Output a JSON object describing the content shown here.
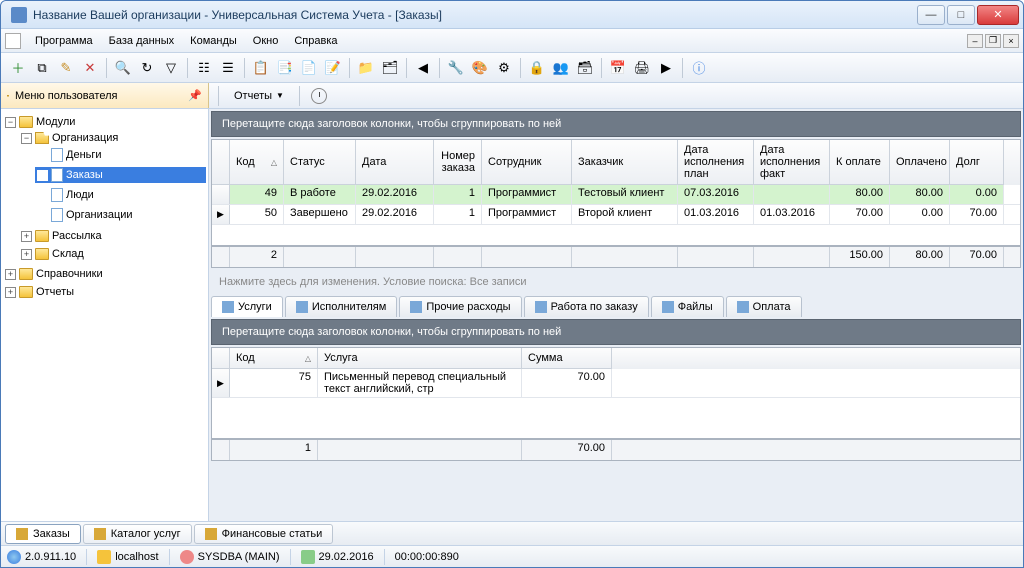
{
  "window": {
    "title": "Название Вашей организации - Универсальная Система Учета - [Заказы]"
  },
  "menu": {
    "items": [
      "Программа",
      "База данных",
      "Команды",
      "Окно",
      "Справка"
    ]
  },
  "usermenu": {
    "label": "Меню пользователя"
  },
  "reports": {
    "label": "Отчеты"
  },
  "tree": {
    "modules": "Модули",
    "org": "Организация",
    "money": "Деньги",
    "orders": "Заказы",
    "people": "Люди",
    "orgs": "Организации",
    "mail": "Рассылка",
    "warehouse": "Склад",
    "refs": "Справочники",
    "rpts": "Отчеты"
  },
  "groupbar_text": "Перетащите сюда заголовок колонки, чтобы сгруппировать по ней",
  "grid": {
    "headers": {
      "kod": "Код",
      "status": "Статус",
      "data": "Дата",
      "nomer": "Номер заказа",
      "sotr": "Сотрудник",
      "zak": "Заказчик",
      "plan": "Дата исполнения план",
      "fact": "Дата исполнения факт",
      "opl": "К оплате",
      "paid": "Оплачено",
      "dolg": "Долг"
    },
    "rows": [
      {
        "kod": "49",
        "status": "В работе",
        "data": "29.02.2016",
        "nomer": "1",
        "sotr": "Программист",
        "zak": "Тестовый клиент",
        "plan": "07.03.2016",
        "fact": "",
        "opl": "80.00",
        "paid": "80.00",
        "dolg": "0.00",
        "green": true
      },
      {
        "kod": "50",
        "status": "Завершено",
        "data": "29.02.2016",
        "nomer": "1",
        "sotr": "Программист",
        "zak": "Второй клиент",
        "plan": "01.03.2016",
        "fact": "01.03.2016",
        "opl": "70.00",
        "paid": "0.00",
        "dolg": "70.00",
        "green": false
      }
    ],
    "footer": {
      "count": "2",
      "opl": "150.00",
      "paid": "80.00",
      "dolg": "70.00"
    }
  },
  "search_hint": "Нажмите здесь для изменения. Условие поиска: Все записи",
  "detail_tabs": [
    "Услуги",
    "Исполнителям",
    "Прочие расходы",
    "Работа по заказу",
    "Файлы",
    "Оплата"
  ],
  "detail_grid": {
    "headers": {
      "kod": "Код",
      "usl": "Услуга",
      "sum": "Сумма"
    },
    "rows": [
      {
        "kod": "75",
        "usl": "Письменный перевод специальный текст английский, стр",
        "sum": "70.00"
      }
    ],
    "footer": {
      "count": "1",
      "sum": "70.00"
    }
  },
  "bottom_tabs": [
    "Заказы",
    "Каталог услуг",
    "Финансовые статьи"
  ],
  "status": {
    "ver": "2.0.911.10",
    "host": "localhost",
    "user": "SYSDBA (MAIN)",
    "date": "29.02.2016",
    "time": "00:00:00:890"
  }
}
